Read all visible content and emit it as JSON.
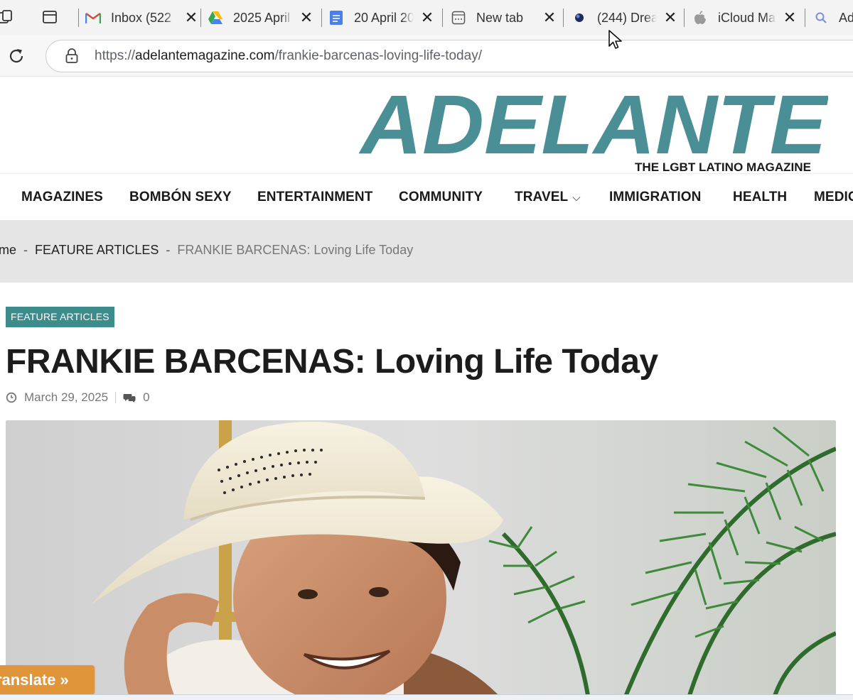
{
  "browser": {
    "tabs": [
      {
        "title": "Inbox (522",
        "icon": "gmail-icon"
      },
      {
        "title": "2025 April",
        "icon": "google-drive-icon"
      },
      {
        "title": "20 April 20",
        "icon": "google-docs-icon"
      },
      {
        "title": "New tab",
        "icon": "new-tab-icon"
      },
      {
        "title": "(244) Drea",
        "icon": "generic-site-icon"
      },
      {
        "title": "iCloud Ma",
        "icon": "apple-icon"
      },
      {
        "title": "Ad",
        "icon": "search-icon"
      }
    ],
    "tab_close_glyph": "✕",
    "url": {
      "scheme": "https://",
      "host": "adelantemagazine.com",
      "path": "/frankie-barcenas-loving-life-today/"
    }
  },
  "site": {
    "logo_text": "ADELANTE",
    "logo_tagline": "THE LGBT LATINO MAGAZINE",
    "brand_color": "#4a8f96",
    "accent_color": "#3d8c8c",
    "nav": [
      {
        "label": "MAGAZINES"
      },
      {
        "label": "BOMBÓN SEXY"
      },
      {
        "label": "ENTERTAINMENT"
      },
      {
        "label": "COMMUNITY"
      },
      {
        "label": "TRAVEL",
        "has_dropdown": true
      },
      {
        "label": "IMMIGRATION"
      },
      {
        "label": "HEALTH"
      },
      {
        "label": "MEDIC"
      }
    ],
    "breadcrumb": {
      "home": "ome",
      "separator": "-",
      "section": "FEATURE ARTICLES",
      "current": "FRANKIE BARCENAS: Loving Life Today"
    }
  },
  "article": {
    "category": "FEATURE ARTICLES",
    "title": "FRANKIE BARCENAS: Loving Life Today",
    "date": "March 29, 2025",
    "comments": "0"
  },
  "translate": {
    "label": "ranslate »",
    "color": "#e0953a"
  }
}
